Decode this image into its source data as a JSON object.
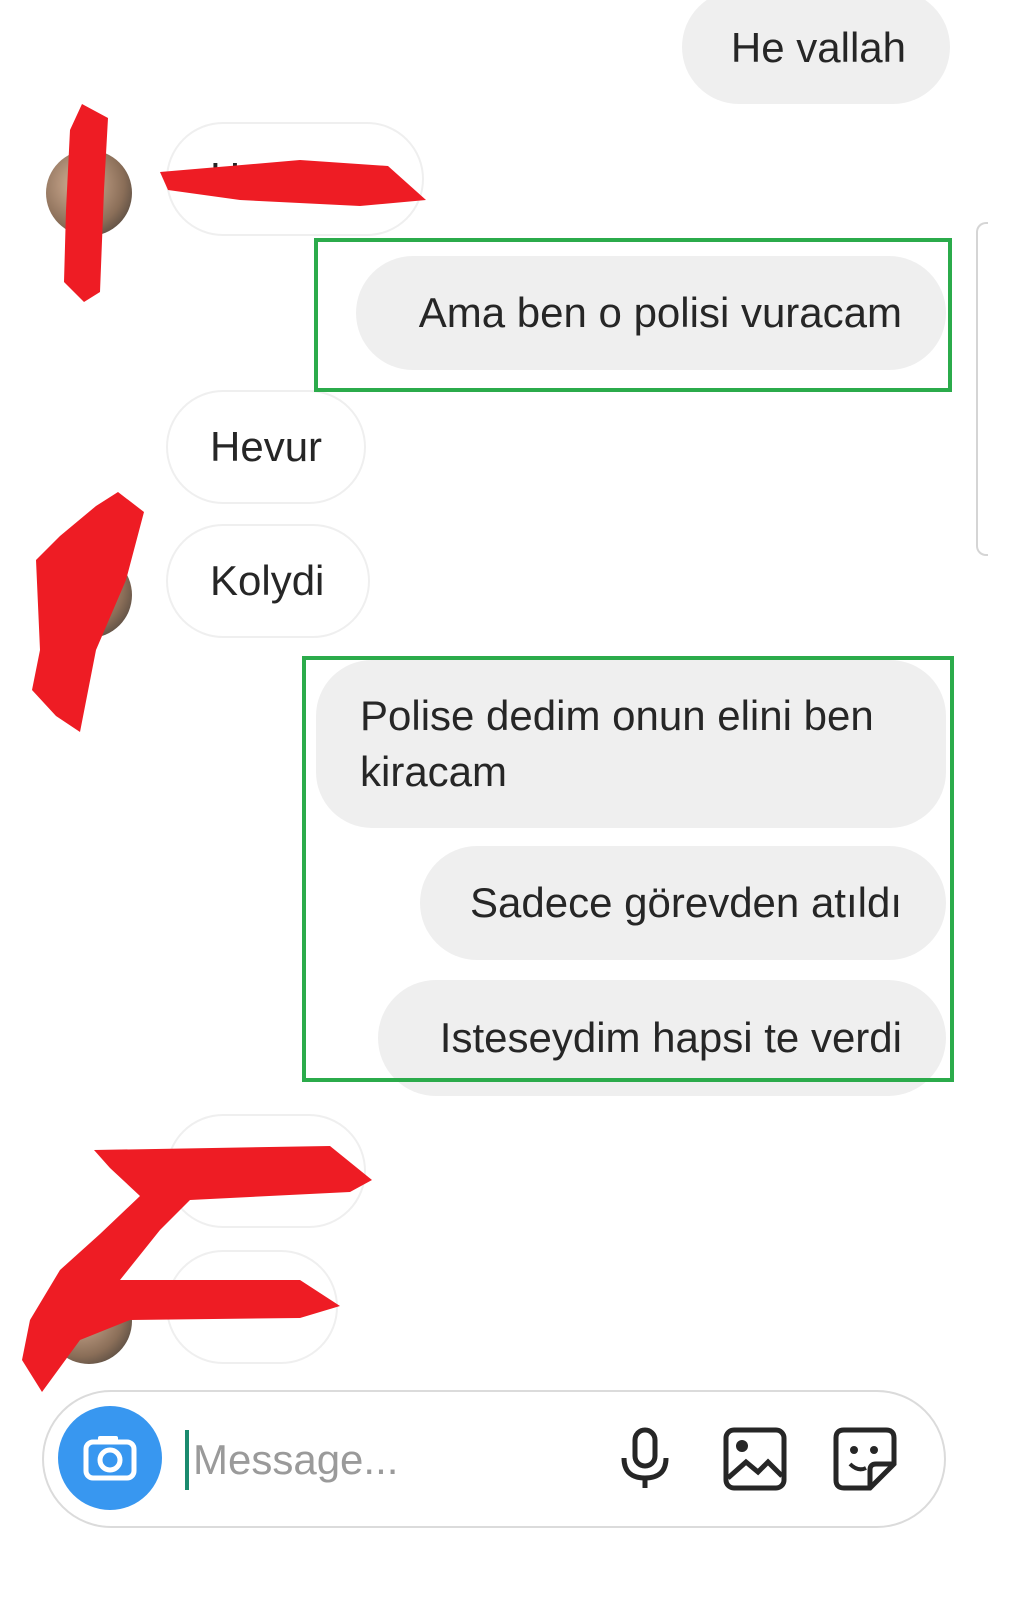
{
  "messages": {
    "out_1": "He vallah",
    "in_1": "H",
    "out_2": "Ama ben o polisi vuracam",
    "in_2": "Hevur",
    "in_3": "Kolydi",
    "out_3": "Polise dedim onun elini ben kiracam",
    "out_4": "Sadece görevden atıldı",
    "out_5": "Isteseydim hapsi te verdi",
    "in_4": "",
    "in_5": ""
  },
  "composer": {
    "placeholder": "Message..."
  },
  "icons": {
    "camera": "camera-icon",
    "mic": "microphone-icon",
    "gallery": "gallery-icon",
    "sticker": "sticker-icon"
  },
  "colors": {
    "outgoing_bubble": "#efefef",
    "accent": "#3897f0",
    "highlight_box": "#2bab4b",
    "redaction": "#ee1c24"
  }
}
